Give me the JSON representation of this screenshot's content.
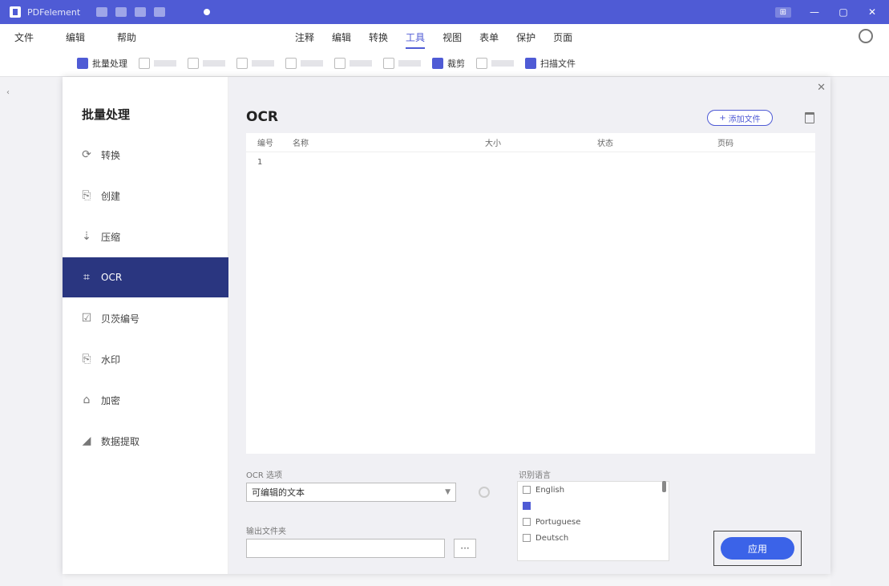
{
  "app": {
    "title": "PDFelement"
  },
  "menubar": {
    "left": [
      "文件",
      "编辑",
      "帮助"
    ],
    "tabs": [
      {
        "label": "注释",
        "active": false
      },
      {
        "label": "编辑",
        "active": false
      },
      {
        "label": "转换",
        "active": false
      },
      {
        "label": "工具",
        "active": true
      },
      {
        "label": "视图",
        "active": false
      },
      {
        "label": "表单",
        "active": false
      },
      {
        "label": "保护",
        "active": false
      },
      {
        "label": "页面",
        "active": false
      }
    ]
  },
  "toolbar": {
    "items": [
      {
        "label": "批量处理",
        "enabled": true,
        "primary": true
      },
      {
        "label": "",
        "enabled": false
      },
      {
        "label": "",
        "enabled": false
      },
      {
        "label": "",
        "enabled": false
      },
      {
        "label": "",
        "enabled": false
      },
      {
        "label": "",
        "enabled": false
      },
      {
        "label": "",
        "enabled": false
      },
      {
        "label": "裁剪",
        "enabled": true,
        "primary": true
      },
      {
        "label": "",
        "enabled": false
      },
      {
        "label": "扫描文件",
        "enabled": true,
        "primary": true
      }
    ]
  },
  "dialog": {
    "nav_title": "批量处理",
    "nav_items": [
      {
        "label": "转换",
        "icon": "convert-icon",
        "glyph": "⟳",
        "active": false
      },
      {
        "label": "创建",
        "icon": "create-icon",
        "glyph": "⎘",
        "active": false
      },
      {
        "label": "压缩",
        "icon": "compress-icon",
        "glyph": "⇣",
        "active": false
      },
      {
        "label": "OCR",
        "icon": "ocr-icon",
        "glyph": "⌗",
        "active": true
      },
      {
        "label": "贝茨编号",
        "icon": "bates-icon",
        "glyph": "☑",
        "active": false
      },
      {
        "label": "水印",
        "icon": "watermark-icon",
        "glyph": "⎘",
        "active": false
      },
      {
        "label": "加密",
        "icon": "encrypt-icon",
        "glyph": "⌂",
        "active": false
      },
      {
        "label": "数据提取",
        "icon": "extract-icon",
        "glyph": "◢",
        "active": false
      }
    ],
    "pane_title": "OCR",
    "add_button": "添加文件",
    "table": {
      "headers": [
        "编号",
        "名称",
        "大小",
        "状态",
        "页码"
      ],
      "rows": [
        {
          "num": "1",
          "name": "",
          "size": "",
          "status": "",
          "pages": ""
        }
      ]
    },
    "ocr_type_label": "OCR 选项",
    "ocr_type_value": "可编辑的文本",
    "output_label": "输出文件夹",
    "output_path": "",
    "browse_label": "···",
    "language_label": "识别语言",
    "languages": [
      {
        "label": "English",
        "checked": false
      },
      {
        "label": "",
        "checked": true
      },
      {
        "label": "Portuguese",
        "checked": false
      },
      {
        "label": "Deutsch",
        "checked": false
      }
    ],
    "apply_button": "应用"
  }
}
